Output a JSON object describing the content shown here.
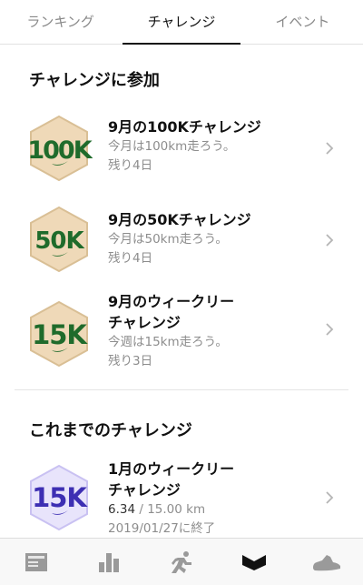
{
  "tabs": [
    {
      "label": "ランキング"
    },
    {
      "label": "チャレンジ"
    },
    {
      "label": "イベント"
    }
  ],
  "active_tab": "チャレンジ",
  "join_section": {
    "title": "チャレンジに参加",
    "items": [
      {
        "badge_text": "100K",
        "title_lines": [
          "9月の100Kチャレンジ"
        ],
        "desc": "今月は100km走ろう。",
        "remaining": "残り4日",
        "badge_style": "green-hex"
      },
      {
        "badge_text": "50K",
        "title_lines": [
          "9月の50Kチャレンジ"
        ],
        "desc": "今月は50km走ろう。",
        "remaining": "残り4日",
        "badge_style": "green-hex"
      },
      {
        "badge_text": "15K",
        "title_lines": [
          "9月のウィークリー",
          "チャレンジ"
        ],
        "desc": "今週は15km走ろう。",
        "remaining": "残り3日",
        "badge_style": "green-hex"
      }
    ]
  },
  "past_section": {
    "title": "これまでのチャレンジ",
    "items": [
      {
        "badge_text": "15K",
        "title_lines": [
          "1月のウィークリー",
          "チャレンジ"
        ],
        "progress_value": "6.34",
        "progress_total": " / 15.00 km",
        "ended": "2019/01/27に終了",
        "badge_style": "purple-hex"
      }
    ]
  },
  "colors": {
    "badge_green_fill": "#efd9b8",
    "badge_green_text": "#1f6b2b",
    "badge_purple_fill": "#e8e4fb",
    "badge_purple_text": "#3d2fb3",
    "active_tab_underline": "#111111"
  },
  "bottom_nav": [
    {
      "icon": "feed-icon"
    },
    {
      "icon": "stats-icon"
    },
    {
      "icon": "run-icon"
    },
    {
      "icon": "challenges-icon"
    },
    {
      "icon": "shoe-icon"
    }
  ]
}
